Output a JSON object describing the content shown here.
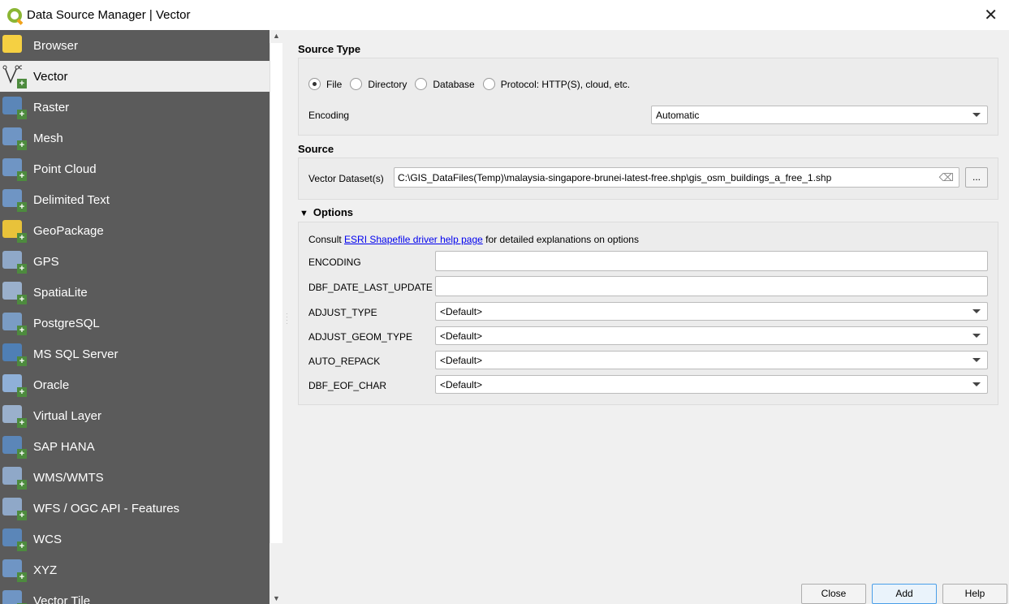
{
  "window": {
    "title": "Data Source Manager | Vector"
  },
  "sidebar": {
    "items": [
      {
        "label": "Browser",
        "color": "#f5d042"
      },
      {
        "label": "Vector",
        "color": "#ffffff"
      },
      {
        "label": "Raster",
        "color": "#5b86b8"
      },
      {
        "label": "Mesh",
        "color": "#6f95c4"
      },
      {
        "label": "Point Cloud",
        "color": "#6f95c4"
      },
      {
        "label": "Delimited Text",
        "color": "#6f95c4"
      },
      {
        "label": "GeoPackage",
        "color": "#e8c23a"
      },
      {
        "label": "GPS",
        "color": "#8fa8c8"
      },
      {
        "label": "SpatiaLite",
        "color": "#9ab0cc"
      },
      {
        "label": "PostgreSQL",
        "color": "#7a9cc4"
      },
      {
        "label": "MS SQL Server",
        "color": "#4f7fb5"
      },
      {
        "label": "Oracle",
        "color": "#8fb0d8"
      },
      {
        "label": "Virtual Layer",
        "color": "#9ab0cc"
      },
      {
        "label": "SAP HANA",
        "color": "#5b86b8"
      },
      {
        "label": "WMS/WMTS",
        "color": "#8fa8c8"
      },
      {
        "label": "WFS / OGC API - Features",
        "color": "#8fa8c8"
      },
      {
        "label": "WCS",
        "color": "#5b86b8"
      },
      {
        "label": "XYZ",
        "color": "#6f95c4"
      },
      {
        "label": "Vector Tile",
        "color": "#6f95c4"
      }
    ]
  },
  "source_type": {
    "heading": "Source Type",
    "options": [
      "File",
      "Directory",
      "Database",
      "Protocol: HTTP(S), cloud, etc."
    ],
    "selected": "File",
    "encoding_label": "Encoding",
    "encoding_value": "Automatic"
  },
  "source": {
    "heading": "Source",
    "dataset_label": "Vector Dataset(s)",
    "dataset_value": "C:\\GIS_DataFiles(Temp)\\malaysia-singapore-brunei-latest-free.shp\\gis_osm_buildings_a_free_1.shp",
    "browse_label": "..."
  },
  "options": {
    "heading": "Options",
    "consult_prefix": "Consult ",
    "link": "ESRI Shapefile driver help page",
    "consult_suffix": " for detailed explanations on options",
    "fields": [
      {
        "label": "ENCODING",
        "type": "text",
        "value": ""
      },
      {
        "label": "DBF_DATE_LAST_UPDATE",
        "type": "text",
        "value": ""
      },
      {
        "label": "ADJUST_TYPE",
        "type": "combo",
        "value": "<Default>"
      },
      {
        "label": "ADJUST_GEOM_TYPE",
        "type": "combo",
        "value": "<Default>"
      },
      {
        "label": "AUTO_REPACK",
        "type": "combo",
        "value": "<Default>"
      },
      {
        "label": "DBF_EOF_CHAR",
        "type": "combo",
        "value": "<Default>"
      }
    ]
  },
  "buttons": {
    "close": "Close",
    "add": "Add",
    "help": "Help"
  }
}
